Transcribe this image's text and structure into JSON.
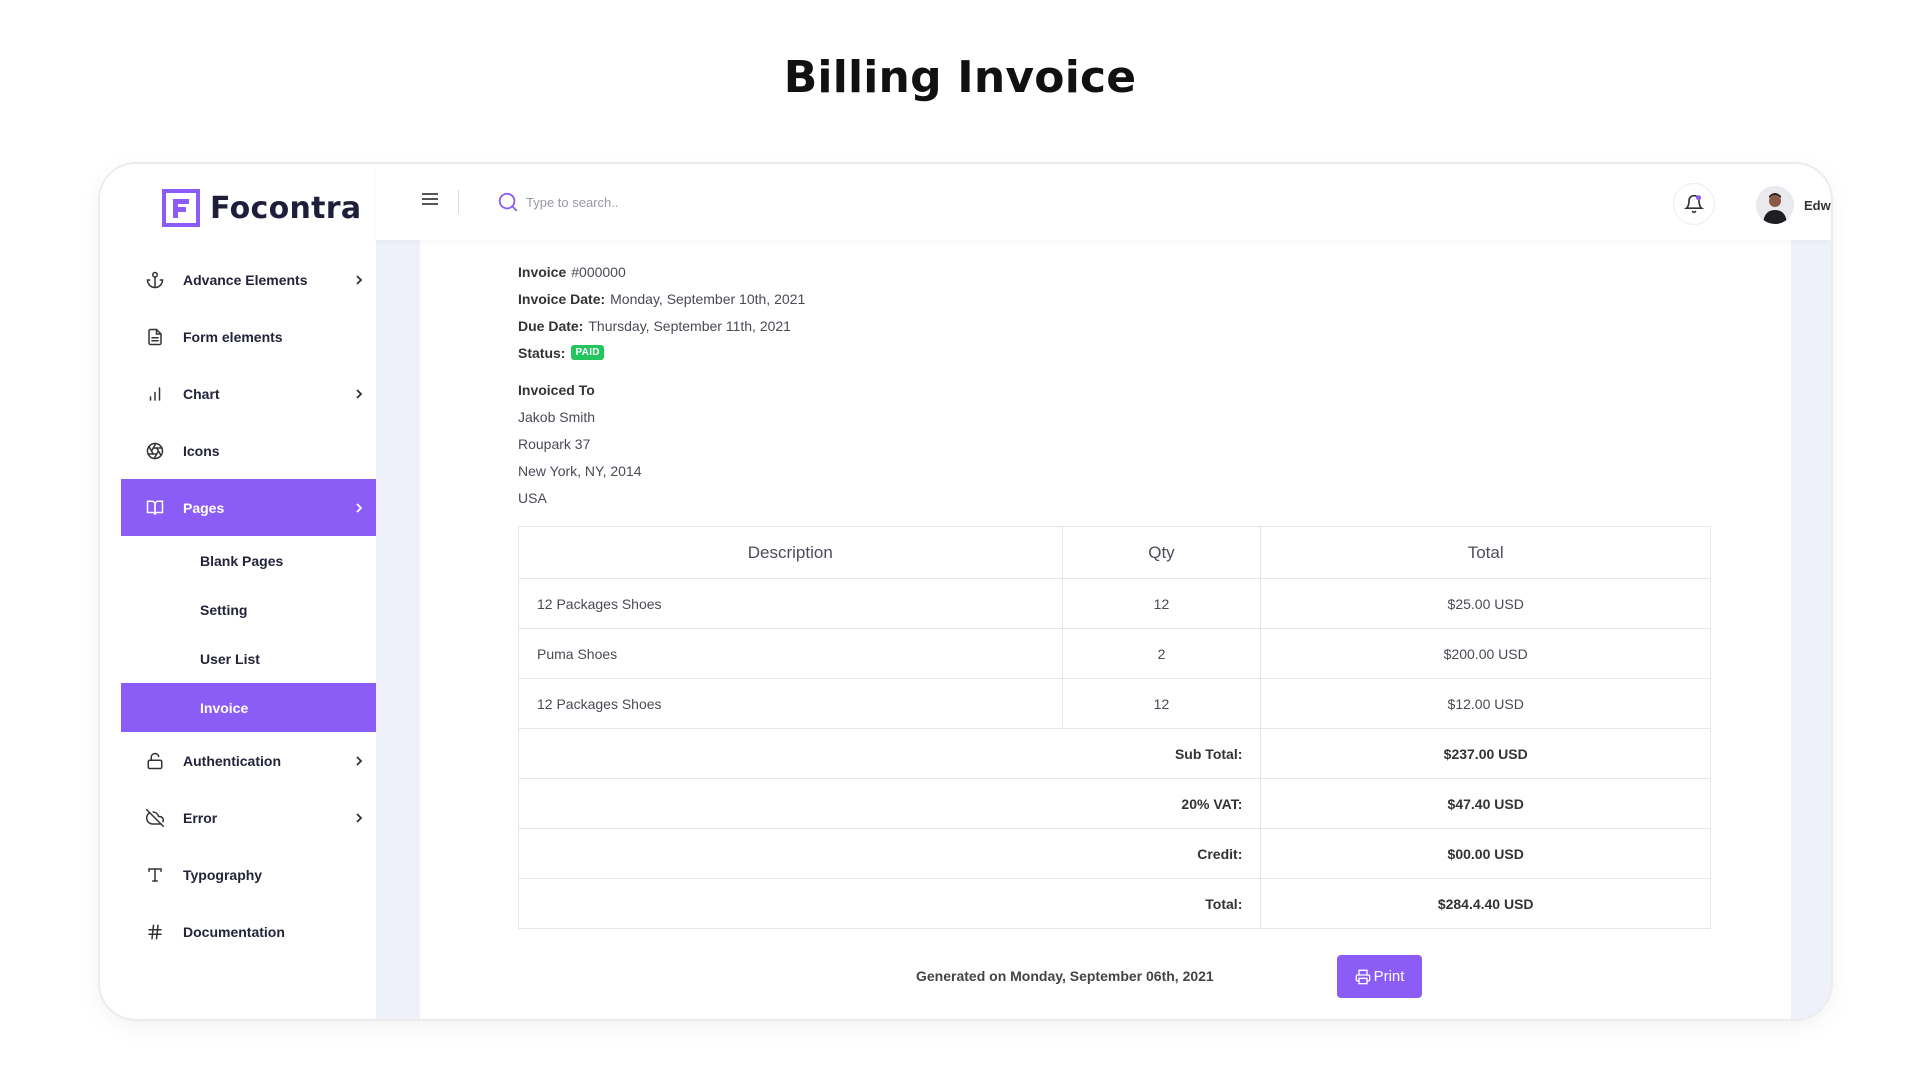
{
  "page_title": "Billing Invoice",
  "brand": {
    "name": "Focontra",
    "accent": "#8b5cf6"
  },
  "sidebar": {
    "items": [
      {
        "label": "Advance Elements",
        "icon": "anchor-icon",
        "has_submenu": true
      },
      {
        "label": "Form elements",
        "icon": "file-text-icon",
        "has_submenu": false
      },
      {
        "label": "Chart",
        "icon": "bar-chart-icon",
        "has_submenu": true
      },
      {
        "label": "Icons",
        "icon": "aperture-icon",
        "has_submenu": false
      },
      {
        "label": "Pages",
        "icon": "book-open-icon",
        "has_submenu": true,
        "active": true
      },
      {
        "label": "Authentication",
        "icon": "unlock-icon",
        "has_submenu": true
      },
      {
        "label": "Error",
        "icon": "cloud-off-icon",
        "has_submenu": true
      },
      {
        "label": "Typography",
        "icon": "type-icon",
        "has_submenu": false
      },
      {
        "label": "Documentation",
        "icon": "hash-icon",
        "has_submenu": false
      }
    ],
    "pages_submenu": [
      "Blank Pages",
      "Setting",
      "User List",
      "Invoice"
    ],
    "active_submenu": "Invoice"
  },
  "header": {
    "search_placeholder": "Type to search..",
    "user_name": "Edward"
  },
  "invoice": {
    "number_label": "Invoice",
    "number": "#000000",
    "date_label": "Invoice Date:",
    "date": "Monday, September 10th, 2021",
    "due_label": "Due Date:",
    "due": "Thursday, September 11th, 2021",
    "status_label": "Status:",
    "status": "PAID",
    "status_color": "#22c55e",
    "to_label": "Invoiced To",
    "to_name": "Jakob Smith",
    "to_street": "Roupark 37",
    "to_city": "New York, NY, 2014",
    "to_country": "USA"
  },
  "table": {
    "headers": [
      "Description",
      "Qty",
      "Total"
    ],
    "rows": [
      {
        "description": "12 Packages Shoes",
        "qty": "12",
        "total": "$25.00 USD"
      },
      {
        "description": "Puma Shoes",
        "qty": "2",
        "total": "$200.00 USD"
      },
      {
        "description": "12 Packages Shoes",
        "qty": "12",
        "total": "$12.00 USD"
      }
    ],
    "summary": [
      {
        "label": "Sub Total:",
        "value": "$237.00 USD"
      },
      {
        "label": "20% VAT:",
        "value": "$47.40 USD"
      },
      {
        "label": "Credit:",
        "value": "$00.00 USD"
      },
      {
        "label": "Total:",
        "value": "$284.4.40 USD"
      }
    ]
  },
  "footer": {
    "generated": "Generated on Monday, September 06th, 2021",
    "print_label": "Print"
  }
}
